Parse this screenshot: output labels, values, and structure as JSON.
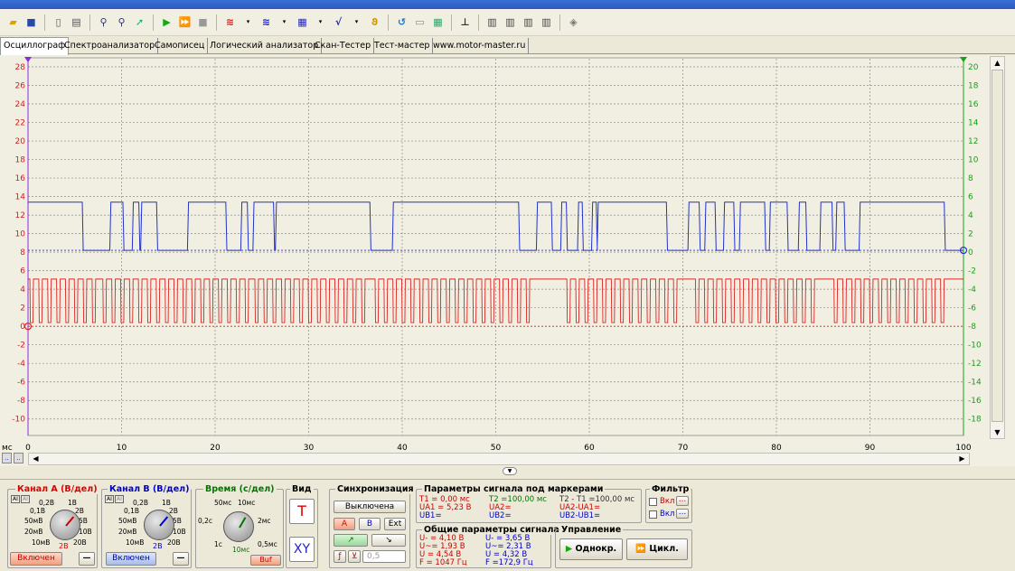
{
  "tabs": [
    "Осциллограф",
    "Спектроанализатор",
    "Самописец",
    "Логический анализатор",
    "Скан-Тестер",
    "Тест-мастер",
    "www.motor-master.ru"
  ],
  "plot": {
    "left_axis": [
      "28",
      "26",
      "24",
      "22",
      "20",
      "18",
      "16",
      "14",
      "12",
      "10",
      "8",
      "6",
      "4",
      "2",
      "0",
      "-2",
      "-4",
      "-6",
      "-8",
      "-10"
    ],
    "right_axis": [
      "20",
      "18",
      "16",
      "14",
      "12",
      "10",
      "8",
      "6",
      "4",
      "2",
      "0",
      "-2",
      "-4",
      "-6",
      "-8",
      "-10",
      "-12",
      "-14",
      "-16",
      "-18"
    ],
    "x_unit": "мс",
    "x_ticks": [
      "0",
      "10",
      "20",
      "30",
      "40",
      "50",
      "60",
      "70",
      "80",
      "90",
      "100"
    ],
    "colors": {
      "channel_a": "#dd2222",
      "channel_b": "#2233cc",
      "right_axis": "#1aa01a",
      "grid": "#8c8c8c"
    }
  },
  "chA": {
    "title": "Канал А (В/дел)",
    "button": "Включен",
    "scale": [
      "0,2В",
      "1В",
      "0,1В",
      "2В",
      "50мВ",
      "5В",
      "20мВ",
      "10В",
      "10мВ",
      "20В"
    ],
    "current": "2В"
  },
  "chB": {
    "title": "Канал В (В/дел)",
    "button": "Включен",
    "scale": [
      "0,2В",
      "1В",
      "0,1В",
      "2В",
      "50мВ",
      "5В",
      "20мВ",
      "10В",
      "10мВ",
      "20В"
    ],
    "current": "2В"
  },
  "time": {
    "title": "Время (с/дел)",
    "labels": [
      "50мс",
      "10мс",
      "0,2с",
      "2мс",
      "1с",
      "0,5мс",
      "10мс"
    ],
    "buf": "Buf"
  },
  "view": {
    "title": "Вид",
    "t": "T",
    "xy": "XY"
  },
  "sync": {
    "title": "Синхронизация",
    "off": "Выключена",
    "a": "A",
    "b": "B",
    "ext": "Ext",
    "level": "0,5"
  },
  "markers": {
    "title": "Параметры сигнала под маркерами",
    "t1": "T1 = 0,00 мс",
    "ua1": "UA1 = 5,23 В",
    "ub1": "UB1=",
    "t2": "T2 =100,00 мс",
    "ua2": "UA2=",
    "ub2": "UB2=",
    "dt": "T2 - T1 =100,00 мс",
    "dua": "UA2-UA1=",
    "dub": "UB2-UB1="
  },
  "common": {
    "title": "Общие параметры сигнала",
    "a": [
      "U- = 4,10 В",
      "U~= 1,93 В",
      "U = 4,54 В",
      "F = 1047 Гц"
    ],
    "b": [
      "U- = 3,65 В",
      "U~= 2,31 В",
      "U = 4,32 В",
      "F =172,9 Гц"
    ]
  },
  "filter": {
    "title": "Фильтр",
    "on1": "Вкл",
    "on2": "Вкл"
  },
  "control": {
    "title": "Управление",
    "single": "Однокр.",
    "cycle": "Цикл."
  }
}
